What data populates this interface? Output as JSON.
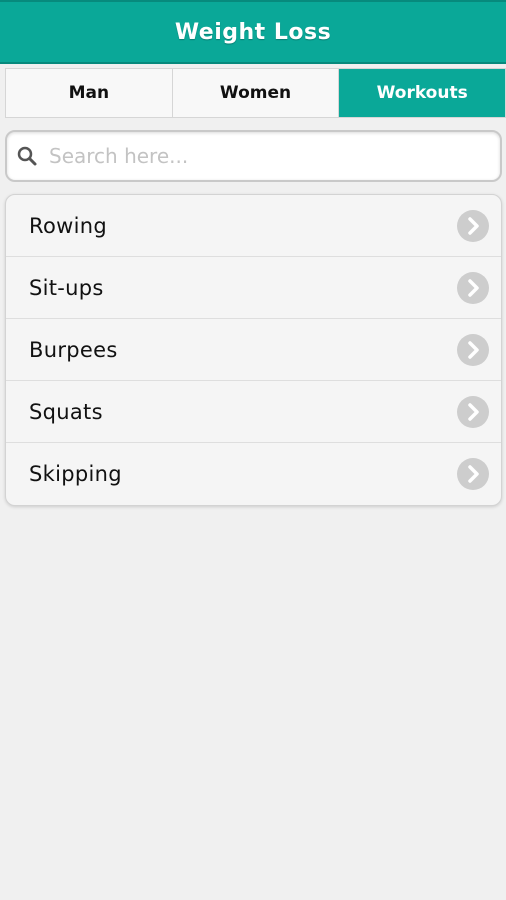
{
  "header": {
    "title": "Weight Loss"
  },
  "tabs": [
    {
      "label": "Man",
      "active": false
    },
    {
      "label": "Women",
      "active": false
    },
    {
      "label": "Workouts",
      "active": true
    }
  ],
  "search": {
    "placeholder": "Search here...",
    "value": ""
  },
  "list": {
    "items": [
      {
        "label": "Rowing"
      },
      {
        "label": "Sit-ups"
      },
      {
        "label": "Burpees"
      },
      {
        "label": "Squats"
      },
      {
        "label": "Skipping"
      }
    ]
  },
  "colors": {
    "accent": "#0aa898",
    "background": "#f0f0f0",
    "chevron": "#cdcdcd"
  },
  "icons": {
    "search": "search-icon",
    "chevron": "chevron-right-icon"
  }
}
